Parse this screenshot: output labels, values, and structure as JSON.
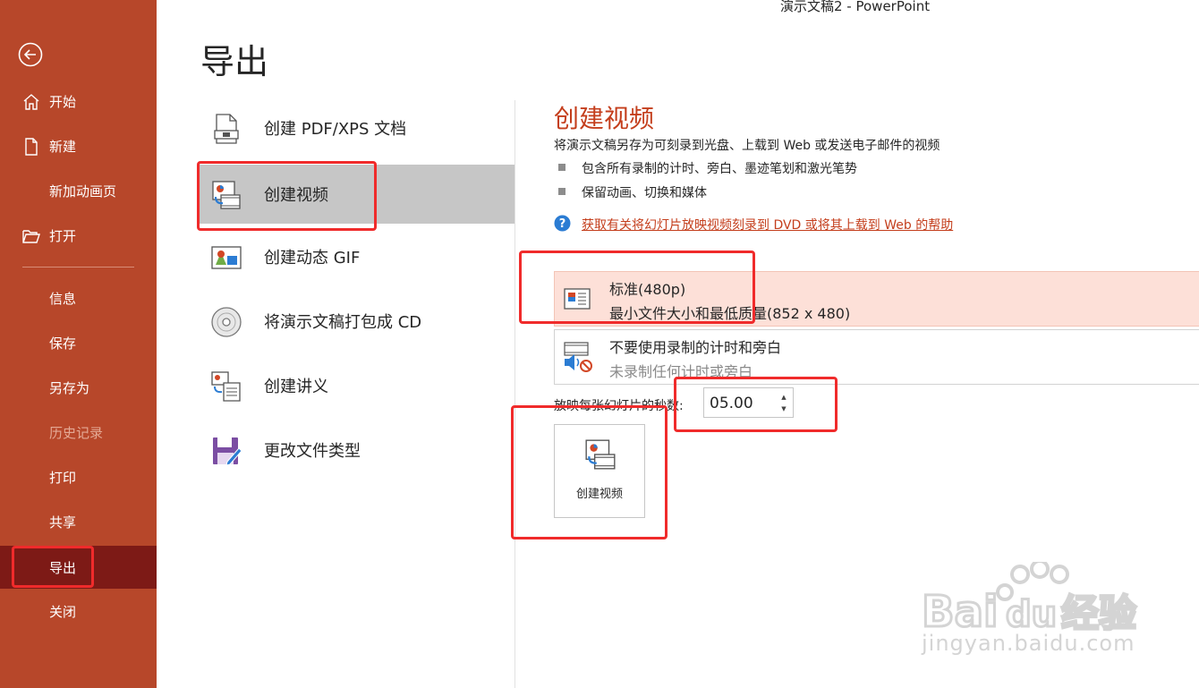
{
  "window_title": "演示文稿2  -  PowerPoint",
  "page_title": "导出",
  "colors": {
    "sidebar": "#b7472a",
    "sidebar_active": "#7d1a16",
    "accent": "#c43e1c",
    "highlight_box": "#f02b2b"
  },
  "sidebar": {
    "back_icon": "back-arrow-icon",
    "items": [
      {
        "label": "开始",
        "icon": "home-icon"
      },
      {
        "label": "新建",
        "icon": "new-document-icon"
      },
      {
        "label": "新加动画页",
        "icon": ""
      },
      {
        "label": "打开",
        "icon": "open-folder-icon"
      },
      {
        "label": "信息"
      },
      {
        "label": "保存"
      },
      {
        "label": "另存为"
      },
      {
        "label": "历史记录",
        "disabled": true
      },
      {
        "label": "打印"
      },
      {
        "label": "共享"
      },
      {
        "label": "导出",
        "active": true
      },
      {
        "label": "关闭"
      }
    ]
  },
  "export_options": [
    {
      "label": "创建 PDF/XPS 文档",
      "icon": "pdf-document-icon"
    },
    {
      "label": "创建视频",
      "icon": "create-video-icon",
      "selected": true
    },
    {
      "label": "创建动态 GIF",
      "icon": "gif-image-icon"
    },
    {
      "label": "将演示文稿打包成 CD",
      "icon": "cd-icon"
    },
    {
      "label": "创建讲义",
      "icon": "handout-icon"
    },
    {
      "label": "更改文件类型",
      "icon": "change-file-type-icon"
    }
  ],
  "video_panel": {
    "title": "创建视频",
    "description": "将演示文稿另存为可刻录到光盘、上载到 Web 或发送电子邮件的视频",
    "bullets": [
      "包含所有录制的计时、旁白、墨迹笔划和激光笔势",
      "保留动画、切换和媒体"
    ],
    "help_link": "获取有关将幻灯片放映视频刻录到 DVD 或将其上载到 Web 的帮助",
    "quality": {
      "title": "标准(480p)",
      "subtitle": "最小文件大小和最低质量(852 x 480)"
    },
    "timing": {
      "title": "不要使用录制的计时和旁白",
      "subtitle": "未录制任何计时或旁白"
    },
    "seconds_label": "放映每张幻灯片的秒数:",
    "seconds_value": "05.00",
    "create_button": "创建视频"
  },
  "watermark": {
    "text": "jingyan.baidu.com",
    "logo": "Bai du 经验"
  }
}
